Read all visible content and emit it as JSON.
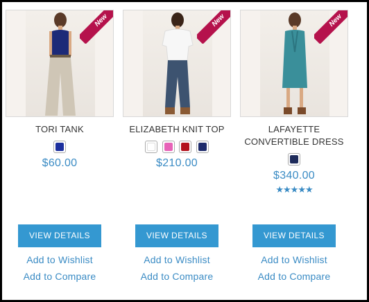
{
  "colors": {
    "accent": "#3498d1",
    "price": "#3a8bc4",
    "ribbon": "#b5124c"
  },
  "products": [
    {
      "name": "TORI TANK",
      "badge": "New",
      "swatches": [
        "#1c2f9e"
      ],
      "price": "$60.00",
      "rating": null,
      "view_details": "VIEW DETAILS",
      "add_to_wishlist": "Add to Wishlist",
      "add_to_compare": "Add to Compare"
    },
    {
      "name": "ELIZABETH KNIT TOP",
      "badge": "New",
      "swatches": [
        "#ffffff",
        "#e763b8",
        "#b3121d",
        "#1e2b6b"
      ],
      "price": "$210.00",
      "rating": null,
      "view_details": "VIEW DETAILS",
      "add_to_wishlist": "Add to Wishlist",
      "add_to_compare": "Add to Compare"
    },
    {
      "name": "LAFAYETTE CONVERTIBLE DRESS",
      "badge": "New",
      "swatches": [
        "#1e2b5b"
      ],
      "price": "$340.00",
      "rating": 5,
      "rating_max": 5,
      "view_details": "VIEW DETAILS",
      "add_to_wishlist": "Add to Wishlist",
      "add_to_compare": "Add to Compare"
    }
  ]
}
